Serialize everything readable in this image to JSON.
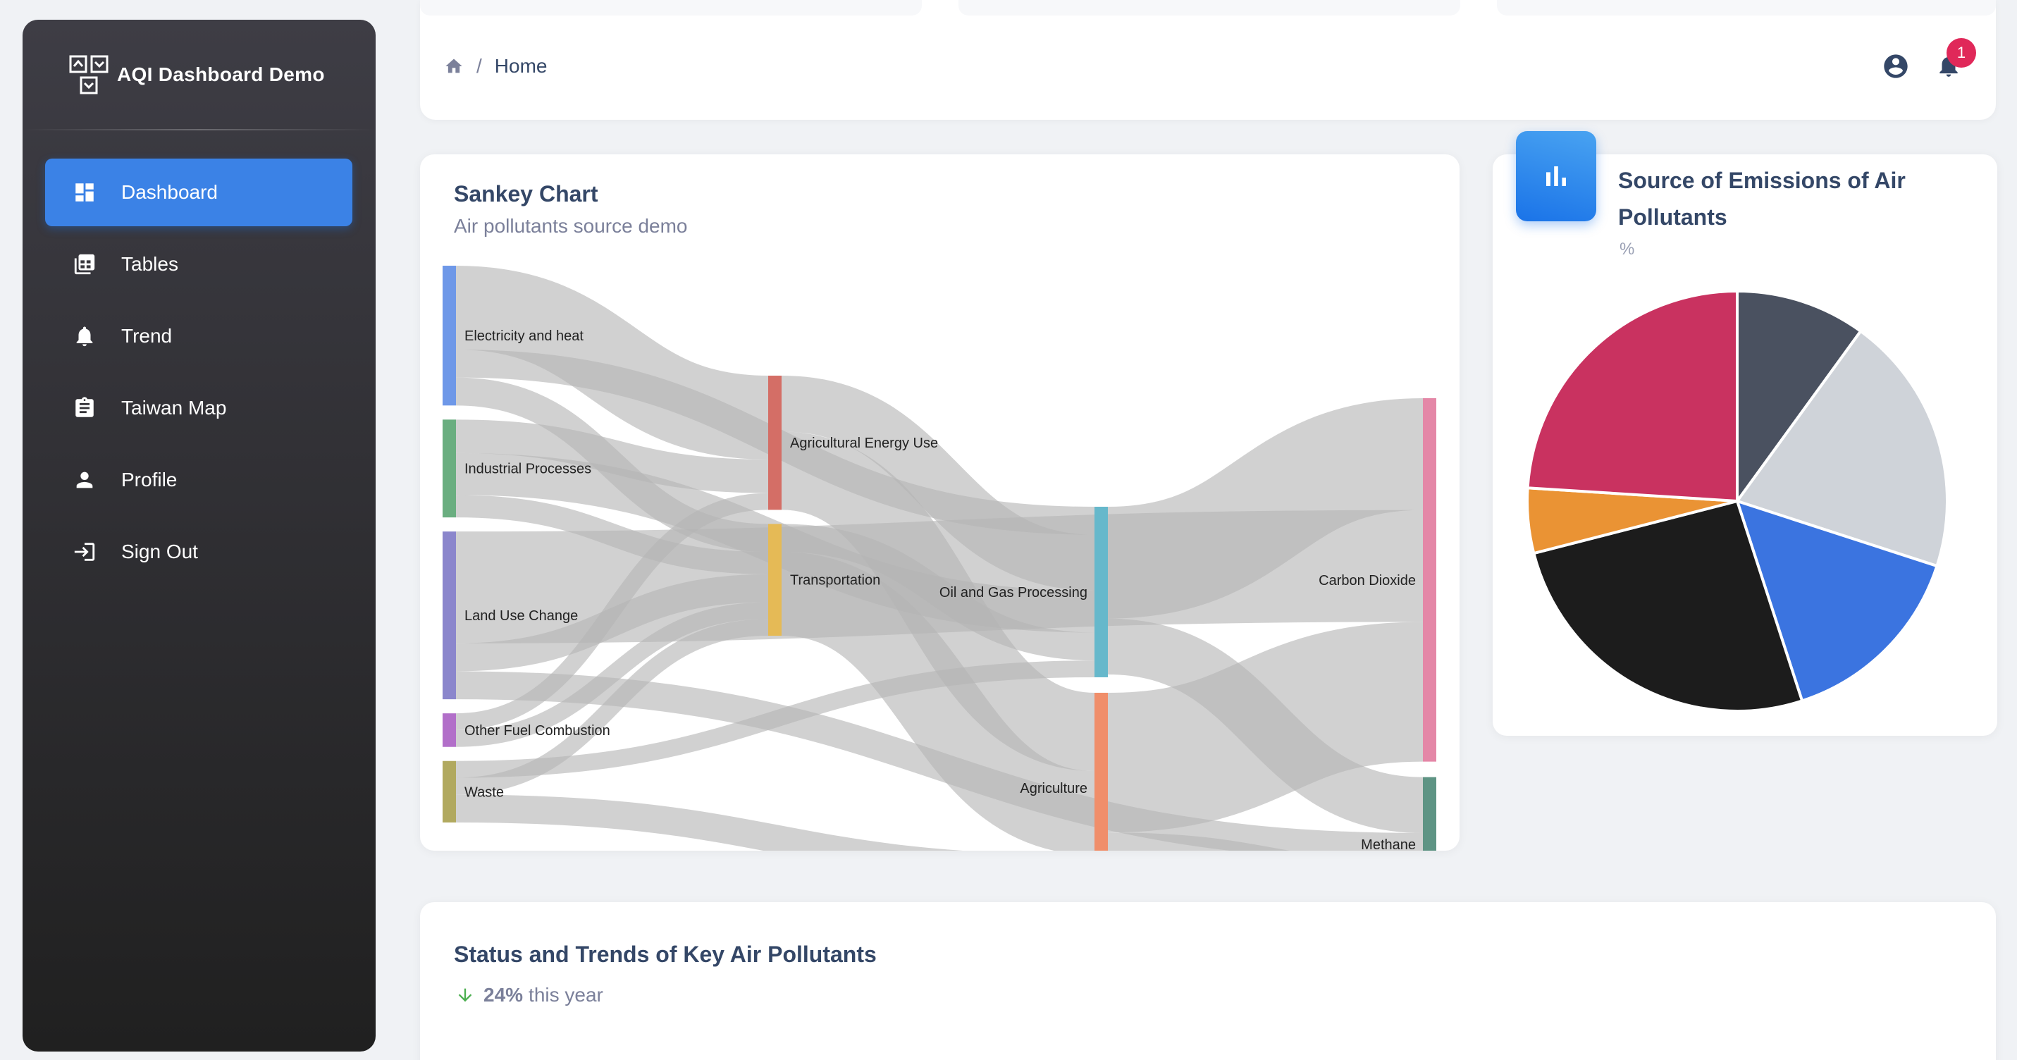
{
  "app": {
    "title": "AQI Dashboard Demo"
  },
  "sidebar": {
    "items": [
      {
        "label": "Dashboard",
        "icon": "dashboard-icon",
        "active": true
      },
      {
        "label": "Tables",
        "icon": "table-icon",
        "active": false
      },
      {
        "label": "Trend",
        "icon": "bell-icon",
        "active": false
      },
      {
        "label": "Taiwan Map",
        "icon": "clipboard-icon",
        "active": false
      },
      {
        "label": "Profile",
        "icon": "person-icon",
        "active": false
      },
      {
        "label": "Sign Out",
        "icon": "login-icon",
        "active": false
      }
    ]
  },
  "header": {
    "breadcrumb": {
      "home_icon": "home-icon",
      "separator": "/",
      "current": "Home"
    },
    "notifications_count": "1"
  },
  "sankey": {
    "title": "Sankey Chart",
    "subtitle": "Air pollutants source demo"
  },
  "pie": {
    "title": "Source of Emissions of Air Pollutants",
    "unit": "%"
  },
  "status": {
    "title": "Status and Trends of Key Air Pollutants",
    "change": "24%",
    "change_suffix": "this year",
    "direction": "down"
  },
  "chart_data": [
    {
      "type": "sankey",
      "title": "Sankey Chart",
      "nodes": [
        {
          "name": "Electricity and heat",
          "color": "#6e98e8"
        },
        {
          "name": "Industrial Processes",
          "color": "#6aae80"
        },
        {
          "name": "Land Use Change",
          "color": "#8b86cc"
        },
        {
          "name": "Other Fuel Combustion",
          "color": "#b26fc9"
        },
        {
          "name": "Waste",
          "color": "#b1a95f"
        },
        {
          "name": "Agricultural Energy Use",
          "color": "#d46e66"
        },
        {
          "name": "Transportation",
          "color": "#e5ba56"
        },
        {
          "name": "Oil and Gas Processing",
          "color": "#66b8cb"
        },
        {
          "name": "Agriculture",
          "color": "#f08e6a"
        },
        {
          "name": "Carbon Dioxide",
          "color": "#e487a7"
        },
        {
          "name": "Methane",
          "color": "#5e9484"
        }
      ],
      "links": [
        {
          "source": "Electricity and heat",
          "target": "Agricultural Energy Use",
          "value": 30
        },
        {
          "source": "Electricity and heat",
          "target": "Transportation",
          "value": 10
        },
        {
          "source": "Electricity and heat",
          "target": "Oil and Gas Processing",
          "value": 10
        },
        {
          "source": "Industrial Processes",
          "target": "Agricultural Energy Use",
          "value": 12
        },
        {
          "source": "Industrial Processes",
          "target": "Transportation",
          "value": 8
        },
        {
          "source": "Industrial Processes",
          "target": "Oil and Gas Processing",
          "value": 15
        },
        {
          "source": "Land Use Change",
          "target": "Carbon Dioxide",
          "value": 40
        },
        {
          "source": "Land Use Change",
          "target": "Transportation",
          "value": 10
        },
        {
          "source": "Land Use Change",
          "target": "Methane",
          "value": 10
        },
        {
          "source": "Other Fuel Combustion",
          "target": "Agricultural Energy Use",
          "value": 6
        },
        {
          "source": "Other Fuel Combustion",
          "target": "Transportation",
          "value": 6
        },
        {
          "source": "Waste",
          "target": "Transportation",
          "value": 6
        },
        {
          "source": "Waste",
          "target": "Oil and Gas Processing",
          "value": 6
        },
        {
          "source": "Waste",
          "target": "Agriculture",
          "value": 10
        },
        {
          "source": "Agricultural Energy Use",
          "target": "Oil and Gas Processing",
          "value": 20
        },
        {
          "source": "Agricultural Energy Use",
          "target": "Agriculture",
          "value": 28
        },
        {
          "source": "Transportation",
          "target": "Oil and Gas Processing",
          "value": 10
        },
        {
          "source": "Transportation",
          "target": "Agriculture",
          "value": 30
        },
        {
          "source": "Oil and Gas Processing",
          "target": "Carbon Dioxide",
          "value": 40
        },
        {
          "source": "Oil and Gas Processing",
          "target": "Methane",
          "value": 20
        },
        {
          "source": "Agriculture",
          "target": "Carbon Dioxide",
          "value": 50
        },
        {
          "source": "Agriculture",
          "target": "Methane",
          "value": 18
        }
      ]
    },
    {
      "type": "pie",
      "title": "Source of Emissions of Air Pollutants",
      "unit": "%",
      "start_angle_deg": 0,
      "direction": "clockwise",
      "slices": [
        {
          "value": 10,
          "color": "#4a5160"
        },
        {
          "value": 20,
          "color": "#cfd3d9"
        },
        {
          "value": 15,
          "color": "#3b74e0"
        },
        {
          "value": 26,
          "color": "#1c1c1c"
        },
        {
          "value": 5,
          "color": "#ea9334"
        },
        {
          "value": 24,
          "color": "#c93260"
        }
      ]
    }
  ]
}
